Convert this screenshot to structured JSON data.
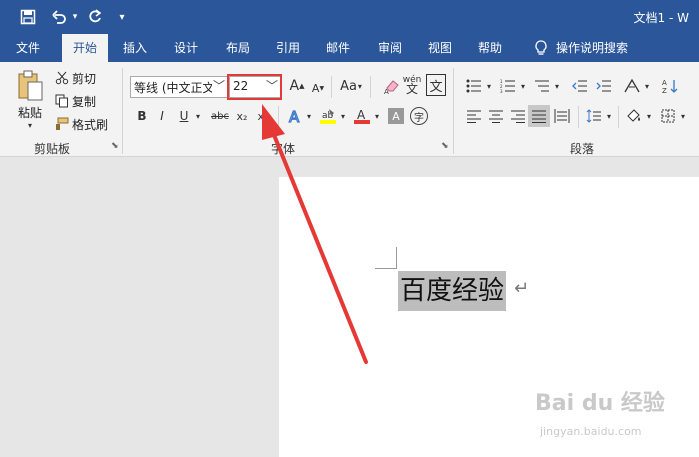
{
  "window": {
    "doc_title": "文档1 - W",
    "qat": {
      "save_icon": "save-icon",
      "undo_icon": "undo-icon",
      "redo_icon": "redo-icon",
      "customize_icon": "customize-qat-icon"
    }
  },
  "tabs": [
    {
      "label": "文件"
    },
    {
      "label": "开始"
    },
    {
      "label": "插入"
    },
    {
      "label": "设计"
    },
    {
      "label": "布局"
    },
    {
      "label": "引用"
    },
    {
      "label": "邮件"
    },
    {
      "label": "审阅"
    },
    {
      "label": "视图"
    },
    {
      "label": "帮助"
    },
    {
      "label": "操作说明搜索"
    }
  ],
  "clipboard": {
    "paste": "粘贴",
    "cut": "剪切",
    "copy": "复制",
    "format_painter": "格式刷",
    "group": "剪贴板"
  },
  "font": {
    "name": "等线 (中文正文",
    "size": "22",
    "group": "字体",
    "bold": "B",
    "italic": "I",
    "underline": "U",
    "strike": "abc",
    "sub": "x₂",
    "sup": "x²",
    "grow": "A",
    "shrink": "A",
    "case": "Aa",
    "phonetic": "文",
    "clear": "清除格式"
  },
  "paragraph": {
    "group": "段落"
  },
  "document": {
    "text": "百度经验",
    "para_mark": "↵"
  },
  "watermark": {
    "text": "Bai du 经验",
    "url": "jingyan.baidu.com"
  },
  "colors": {
    "accent": "#2b579a",
    "ribbon": "#f3f3f3",
    "highlight": "#e53935",
    "arrow": "#e53935"
  }
}
